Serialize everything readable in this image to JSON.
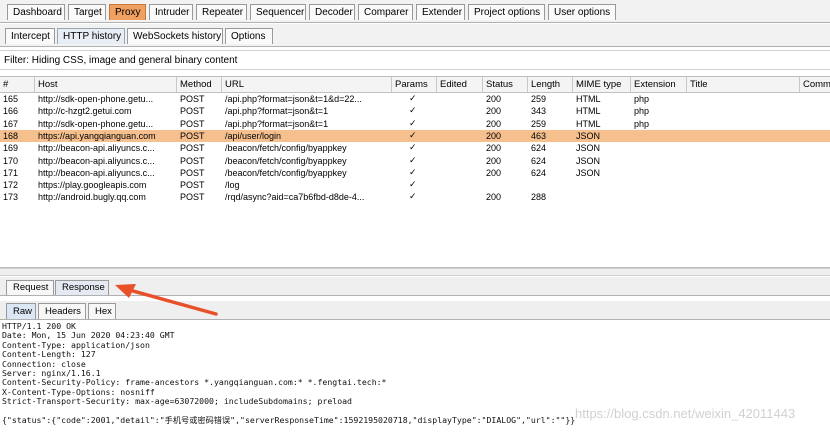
{
  "top_tabs": [
    "Dashboard",
    "Target",
    "Proxy",
    "Intruder",
    "Repeater",
    "Sequencer",
    "Decoder",
    "Comparer",
    "Extender",
    "Project options",
    "User options"
  ],
  "active_top_tab": "Proxy",
  "sub_tabs": [
    "Intercept",
    "HTTP history",
    "WebSockets history",
    "Options"
  ],
  "active_sub_tab": "HTTP history",
  "filter_text": "Filter: Hiding CSS, image and general binary content",
  "columns": [
    "#",
    "Host",
    "Method",
    "URL",
    "Params",
    "Edited",
    "Status",
    "Length",
    "MIME type",
    "Extension",
    "Title",
    "Comm"
  ],
  "rows": [
    {
      "num": "165",
      "host": "http://sdk-open-phone.getu...",
      "method": "POST",
      "url": "/api.php?format=json&t=1&d=22...",
      "params": "✓",
      "edited": "",
      "status": "200",
      "length": "259",
      "mime": "HTML",
      "ext": "php",
      "selected": false
    },
    {
      "num": "166",
      "host": "http://c-hzgt2.getui.com",
      "method": "POST",
      "url": "/api.php?format=json&t=1",
      "params": "✓",
      "edited": "",
      "status": "200",
      "length": "343",
      "mime": "HTML",
      "ext": "php",
      "selected": false
    },
    {
      "num": "167",
      "host": "http://sdk-open-phone.getu...",
      "method": "POST",
      "url": "/api.php?format=json&t=1",
      "params": "✓",
      "edited": "",
      "status": "200",
      "length": "259",
      "mime": "HTML",
      "ext": "php",
      "selected": false
    },
    {
      "num": "168",
      "host": "https://api.yangqianguan.com",
      "method": "POST",
      "url": "/api/user/login",
      "params": "✓",
      "edited": "",
      "status": "200",
      "length": "463",
      "mime": "JSON",
      "ext": "",
      "selected": true
    },
    {
      "num": "169",
      "host": "http://beacon-api.aliyuncs.c...",
      "method": "POST",
      "url": "/beacon/fetch/config/byappkey",
      "params": "✓",
      "edited": "",
      "status": "200",
      "length": "624",
      "mime": "JSON",
      "ext": "",
      "selected": false
    },
    {
      "num": "170",
      "host": "http://beacon-api.aliyuncs.c...",
      "method": "POST",
      "url": "/beacon/fetch/config/byappkey",
      "params": "✓",
      "edited": "",
      "status": "200",
      "length": "624",
      "mime": "JSON",
      "ext": "",
      "selected": false
    },
    {
      "num": "171",
      "host": "http://beacon-api.aliyuncs.c...",
      "method": "POST",
      "url": "/beacon/fetch/config/byappkey",
      "params": "✓",
      "edited": "",
      "status": "200",
      "length": "624",
      "mime": "JSON",
      "ext": "",
      "selected": false
    },
    {
      "num": "172",
      "host": "https://play.googleapis.com",
      "method": "POST",
      "url": "/log",
      "params": "✓",
      "edited": "",
      "status": "",
      "length": "",
      "mime": "",
      "ext": "",
      "selected": false
    },
    {
      "num": "173",
      "host": "http://android.bugly.qq.com",
      "method": "POST",
      "url": "/rqd/async?aid=ca7b6fbd-d8de-4...",
      "params": "✓",
      "edited": "",
      "status": "200",
      "length": "288",
      "mime": "",
      "ext": "",
      "selected": false
    }
  ],
  "req_resp_tabs": [
    "Request",
    "Response"
  ],
  "active_req_resp": "Response",
  "view_tabs": [
    "Raw",
    "Headers",
    "Hex"
  ],
  "active_view": "Raw",
  "response_lines": [
    "HTTP/1.1 200 OK",
    "Date: Mon, 15 Jun 2020 04:23:40 GMT",
    "Content-Type: application/json",
    "Content-Length: 127",
    "Connection: close",
    "Server: nginx/1.16.1",
    "Content-Security-Policy: frame-ancestors *.yangqianguan.com:* *.fengtai.tech:*",
    "X-Content-Type-Options: nosniff",
    "Strict-Transport-Security: max-age=63072000; includeSubdomains; preload",
    "",
    "{\"status\":{\"code\":2001,\"detail\":\"手机号或密码错误\",\"serverResponseTime\":1592195020718,\"displayType\":\"DIALOG\",\"url\":\"\"}}"
  ],
  "watermark": "https://blog.csdn.net/weixin_42011443",
  "colors": {
    "active_tab": "#f0a060",
    "selected_row": "#f5bf8e",
    "arrow": "#e8502a"
  }
}
